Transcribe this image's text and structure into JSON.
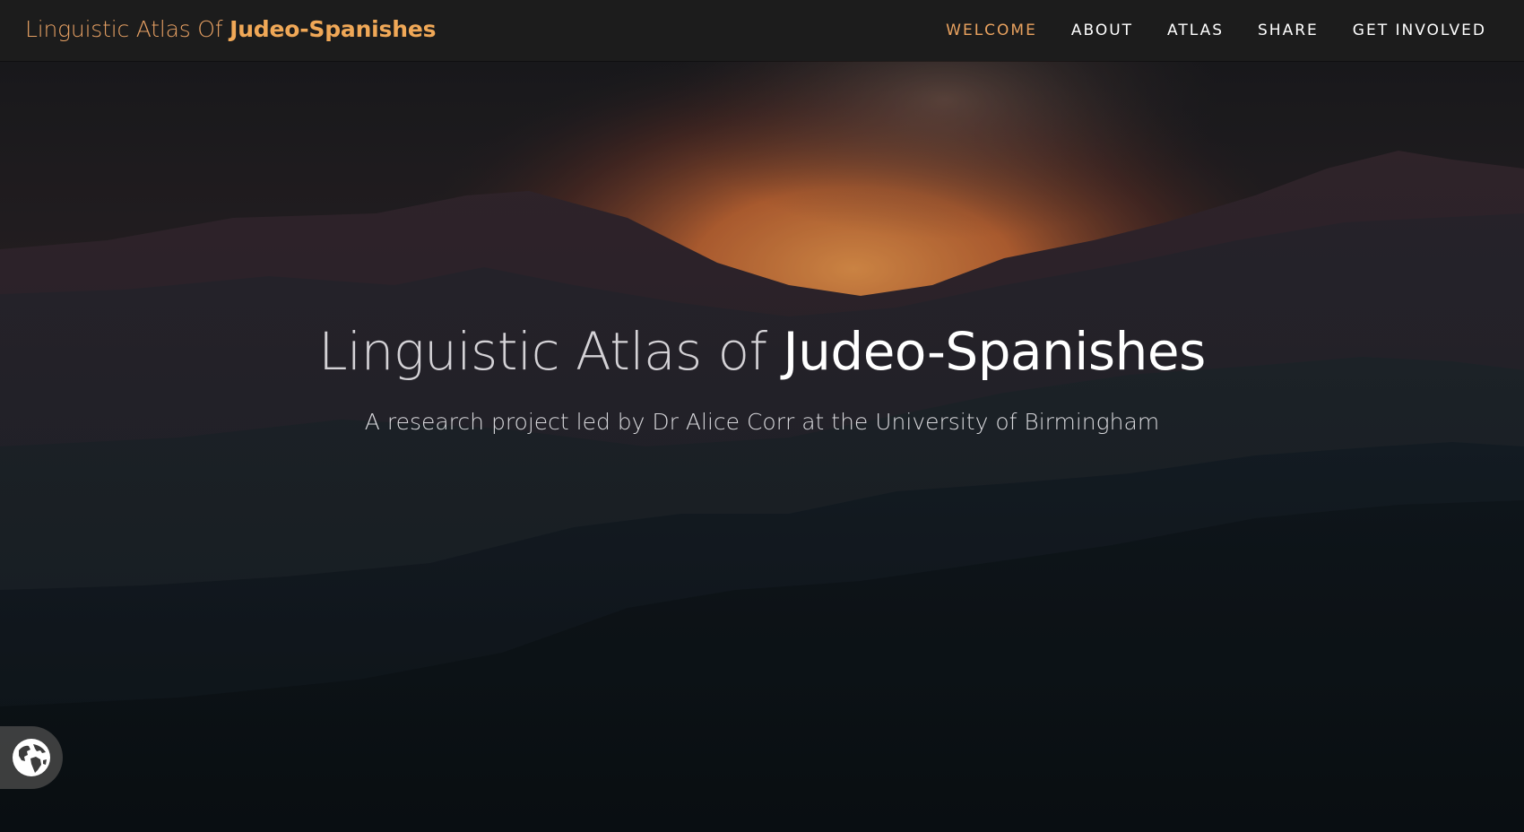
{
  "header": {
    "brand_prefix": "Linguistic Atlas Of ",
    "brand_highlight": "Judeo-Spanishes",
    "nav": [
      {
        "label": "WELCOME",
        "active": true
      },
      {
        "label": "ABOUT",
        "active": false
      },
      {
        "label": "ATLAS",
        "active": false
      },
      {
        "label": "SHARE",
        "active": false
      },
      {
        "label": "GET INVOLVED",
        "active": false
      }
    ]
  },
  "hero": {
    "title_prefix": "Linguistic Atlas of ",
    "title_highlight": "Judeo-Spanishes",
    "subtitle": "A research project led by Dr Alice Corr at the University of Birmingham"
  },
  "floating_button": {
    "icon": "globe-icon"
  },
  "colors": {
    "accent": "#e9a25f",
    "navbar_bg": "#1c1c1c",
    "nav_text": "#ffffff",
    "hero_glow": "#f08a3e"
  }
}
